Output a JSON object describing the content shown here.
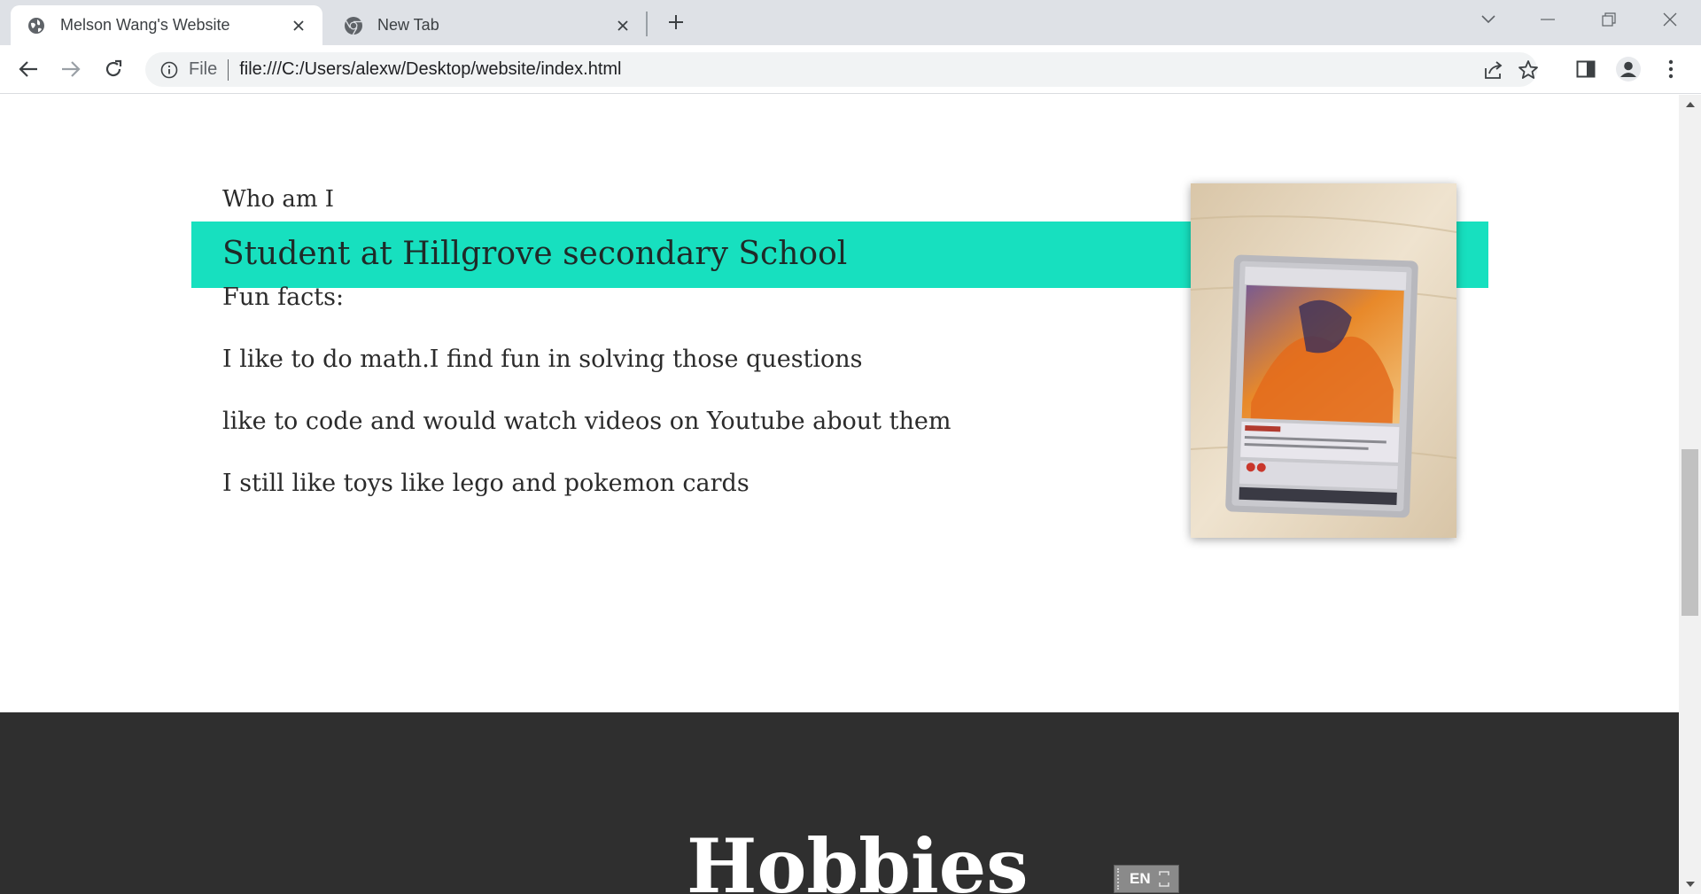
{
  "browser": {
    "tabs": [
      {
        "title": "Melson Wang's Website",
        "active": true,
        "icon": "globe-icon"
      },
      {
        "title": "New Tab",
        "active": false,
        "icon": "chrome-icon"
      }
    ],
    "address": {
      "scheme_label": "File",
      "url": "file:///C:/Users/alexw/Desktop/website/index.html"
    }
  },
  "page": {
    "intro_label": "Who am I",
    "headline": "Student at Hillgrove secondary School",
    "facts_heading": "Fun facts:",
    "facts": [
      "I like to do math.I find fun in solving those questions",
      "like to code and would watch videos on Youtube about them",
      "I still like toys like lego and pokemon cards"
    ],
    "hobbies_heading": "Hobbies",
    "photo_alt": "pokemon-card-photo"
  },
  "ime": {
    "language": "EN"
  },
  "colors": {
    "accent": "#17e0bf",
    "dark_section": "#2f2f2f",
    "tabstrip": "#dee1e6"
  }
}
